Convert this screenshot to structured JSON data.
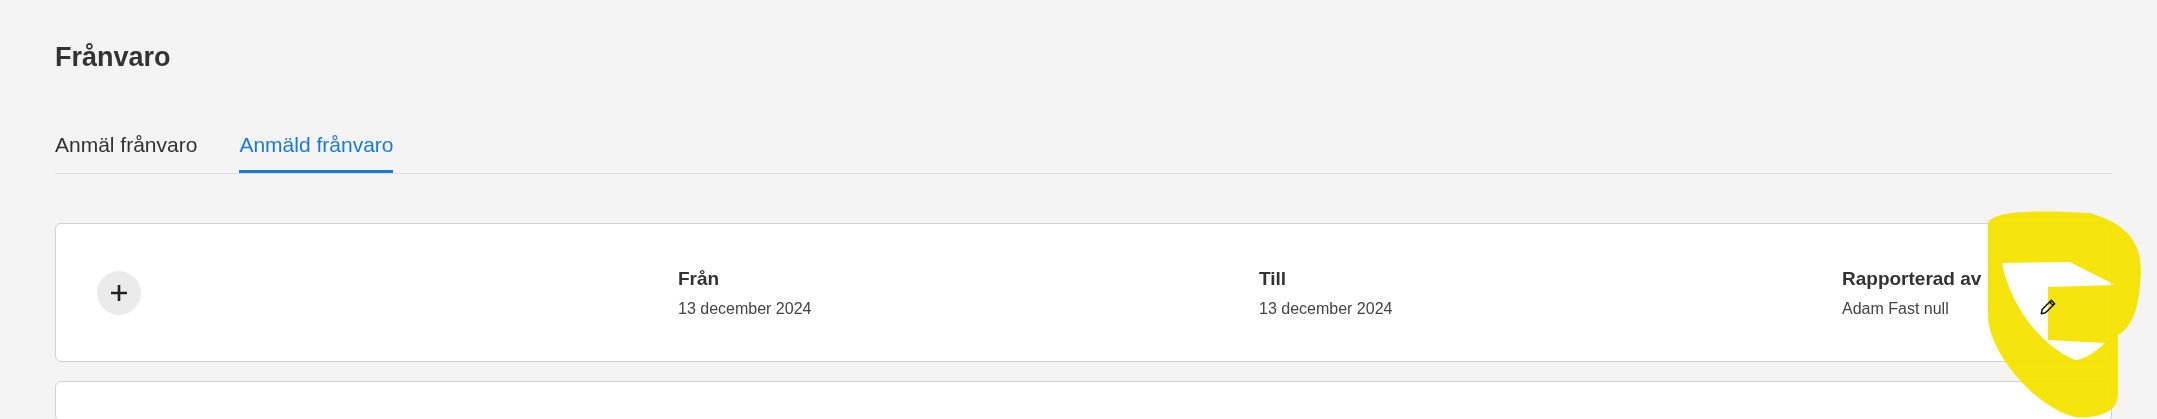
{
  "title": "Frånvaro",
  "tabs": [
    {
      "label": "Anmäl frånvaro",
      "selected": false
    },
    {
      "label": "Anmäld frånvaro",
      "selected": true
    }
  ],
  "records": [
    {
      "from_label": "Från",
      "from": "13 december 2024",
      "to_label": "Till",
      "to": "13 december 2024",
      "reported_by_label": "Rapporterad av",
      "reported_by": "Adam Fast null"
    }
  ]
}
